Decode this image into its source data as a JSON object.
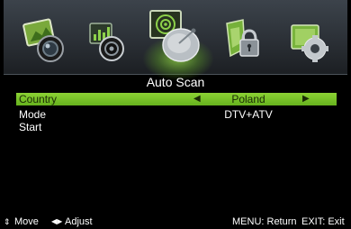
{
  "menu_icons": [
    {
      "name": "picture",
      "selected": false
    },
    {
      "name": "sound",
      "selected": false
    },
    {
      "name": "channel",
      "selected": true
    },
    {
      "name": "lock",
      "selected": false
    },
    {
      "name": "setup",
      "selected": false
    }
  ],
  "title": "Auto Scan",
  "rows": [
    {
      "label": "Country",
      "value": "Poland",
      "selected": true
    },
    {
      "label": "Mode",
      "value": "DTV+ATV",
      "selected": false
    },
    {
      "label": "Start",
      "value": "",
      "selected": false
    }
  ],
  "footer": {
    "move": "Move",
    "adjust": "Adjust",
    "menu": "MENU: Return",
    "exit": "EXIT: Exit"
  },
  "colors": {
    "highlight": "#7cc22a",
    "background": "#000000",
    "iconbar": "#33383e"
  }
}
